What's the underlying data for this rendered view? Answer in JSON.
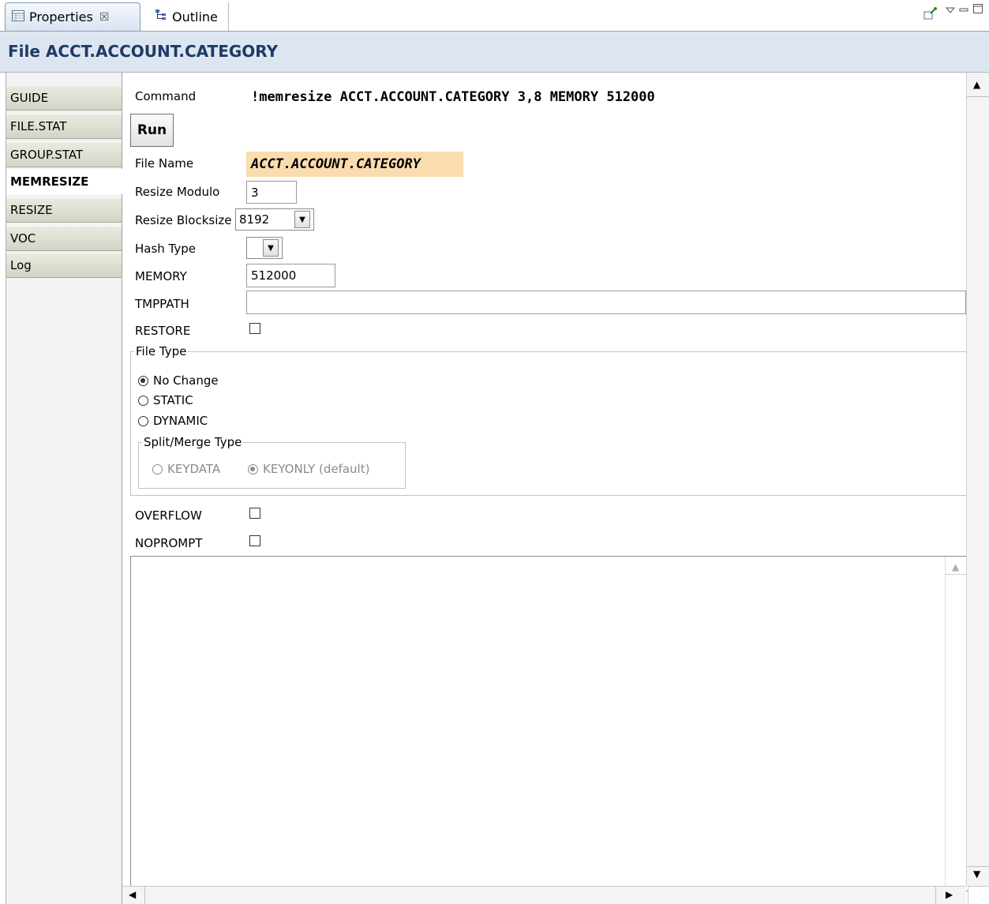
{
  "tabs": [
    {
      "label": "Properties",
      "close": "☒",
      "icon": "properties-table-icon"
    },
    {
      "label": "Outline",
      "icon": "outline-icon"
    }
  ],
  "view_toolbar_icons": [
    "pin-icon",
    "view-menu-icon",
    "minimize-icon",
    "maximize-icon"
  ],
  "view_title": "File ACCT.ACCOUNT.CATEGORY",
  "sidebar": {
    "items": [
      {
        "label": "GUIDE"
      },
      {
        "label": "FILE.STAT"
      },
      {
        "label": "GROUP.STAT"
      },
      {
        "label": "MEMRESIZE",
        "active": true
      },
      {
        "label": "RESIZE"
      },
      {
        "label": "VOC"
      },
      {
        "label": "Log"
      }
    ]
  },
  "form": {
    "command_label": "Command",
    "command_value": "!memresize ACCT.ACCOUNT.CATEGORY 3,8 MEMORY 512000",
    "run_label": "Run",
    "file_name_label": "File Name",
    "file_name_value": "ACCT.ACCOUNT.CATEGORY",
    "resize_modulo_label": "Resize Modulo",
    "resize_modulo_value": "3",
    "resize_blocksize_label": "Resize Blocksize",
    "resize_blocksize_value": "8192",
    "hash_type_label": "Hash Type",
    "hash_type_value": "",
    "memory_label": "MEMORY",
    "memory_value": "512000",
    "tmppath_label": "TMPPATH",
    "tmppath_value": "",
    "restore_label": "RESTORE",
    "restore_checked": false,
    "file_type": {
      "legend": "File Type",
      "options": [
        {
          "label": "No Change",
          "selected": true
        },
        {
          "label": "STATIC",
          "selected": false
        },
        {
          "label": "DYNAMIC",
          "selected": false
        }
      ],
      "split_merge": {
        "legend": "Split/Merge Type",
        "enabled": false,
        "options": [
          {
            "label": "KEYDATA",
            "selected": false
          },
          {
            "label": "KEYONLY (default)",
            "selected": true
          }
        ]
      }
    },
    "overflow_label": "OVERFLOW",
    "overflow_checked": false,
    "noprompt_label": "NOPROMPT",
    "noprompt_checked": false,
    "output_text": ""
  }
}
